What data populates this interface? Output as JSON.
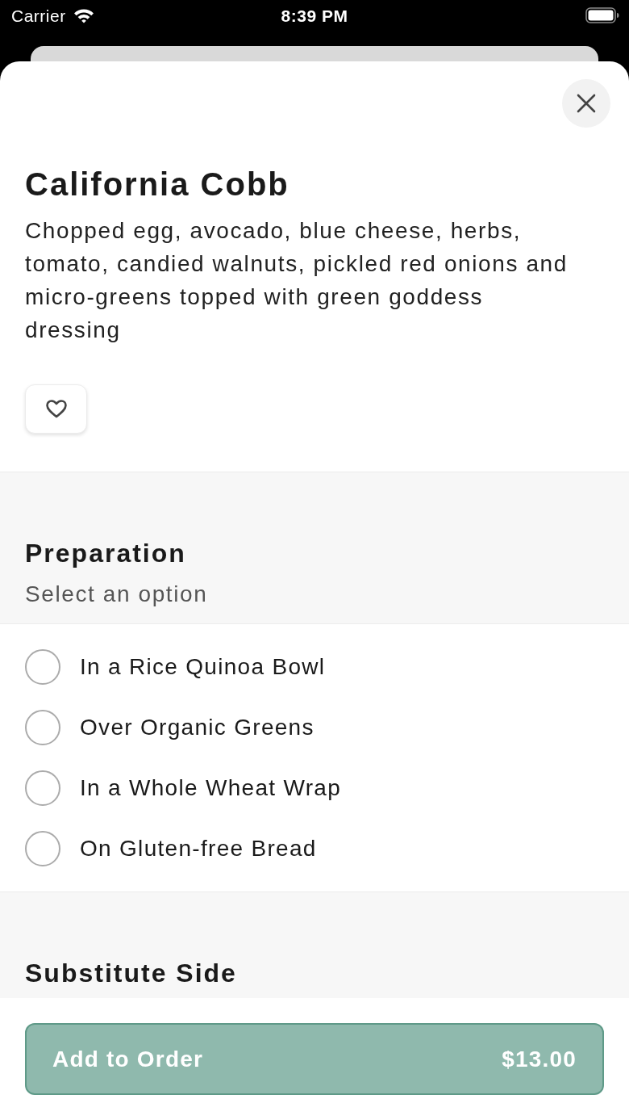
{
  "status_bar": {
    "carrier": "Carrier",
    "time": "8:39 PM"
  },
  "item": {
    "title": "California Cobb",
    "description": "Chopped egg, avocado, blue cheese, herbs, tomato, candied walnuts, pickled red onions and micro-greens topped with green goddess dressing",
    "favorite": false
  },
  "sections": [
    {
      "title": "Preparation",
      "subtitle": "Select an option",
      "options": [
        {
          "label": "In a Rice Quinoa Bowl",
          "selected": false
        },
        {
          "label": "Over Organic Greens",
          "selected": false
        },
        {
          "label": "In a Whole Wheat Wrap",
          "selected": false
        },
        {
          "label": "On Gluten-free Bread",
          "selected": false
        }
      ]
    },
    {
      "title": "Substitute Side"
    }
  ],
  "footer": {
    "button": "Add to Order",
    "price": "$13.00",
    "disabled": true
  }
}
